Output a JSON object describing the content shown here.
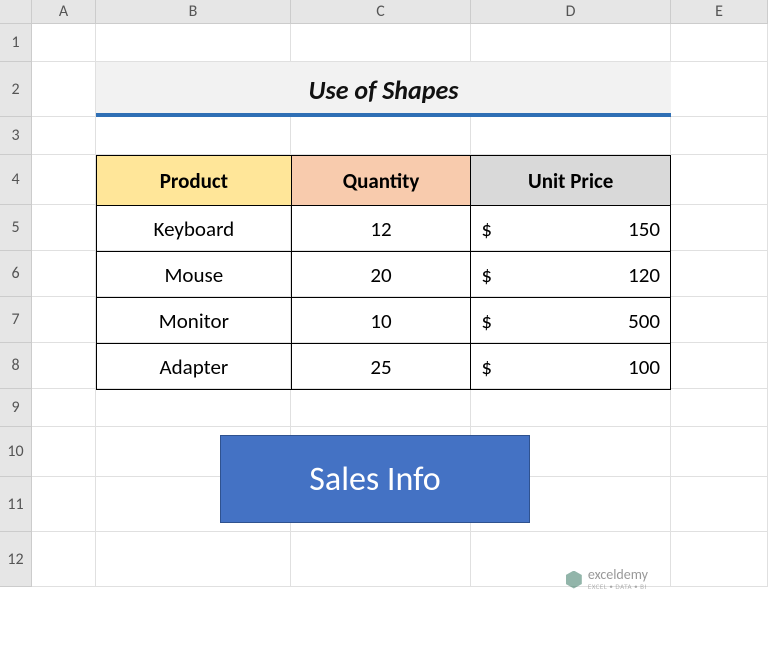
{
  "columns": [
    "A",
    "B",
    "C",
    "D",
    "E"
  ],
  "rows": [
    "1",
    "2",
    "3",
    "4",
    "5",
    "6",
    "7",
    "8",
    "9",
    "10",
    "11",
    "12"
  ],
  "title": "Use of Shapes",
  "table": {
    "headers": {
      "product": "Product",
      "quantity": "Quantity",
      "unit_price": "Unit Price"
    },
    "currency": "$",
    "rows": [
      {
        "product": "Keyboard",
        "quantity": "12",
        "price": "150"
      },
      {
        "product": "Mouse",
        "quantity": "20",
        "price": "120"
      },
      {
        "product": "Monitor",
        "quantity": "10",
        "price": "500"
      },
      {
        "product": "Adapter",
        "quantity": "25",
        "price": "100"
      }
    ]
  },
  "shape": {
    "label": "Sales Info"
  },
  "watermark": {
    "brand": "exceldemy",
    "tagline": "EXCEL • DATA • BI"
  }
}
